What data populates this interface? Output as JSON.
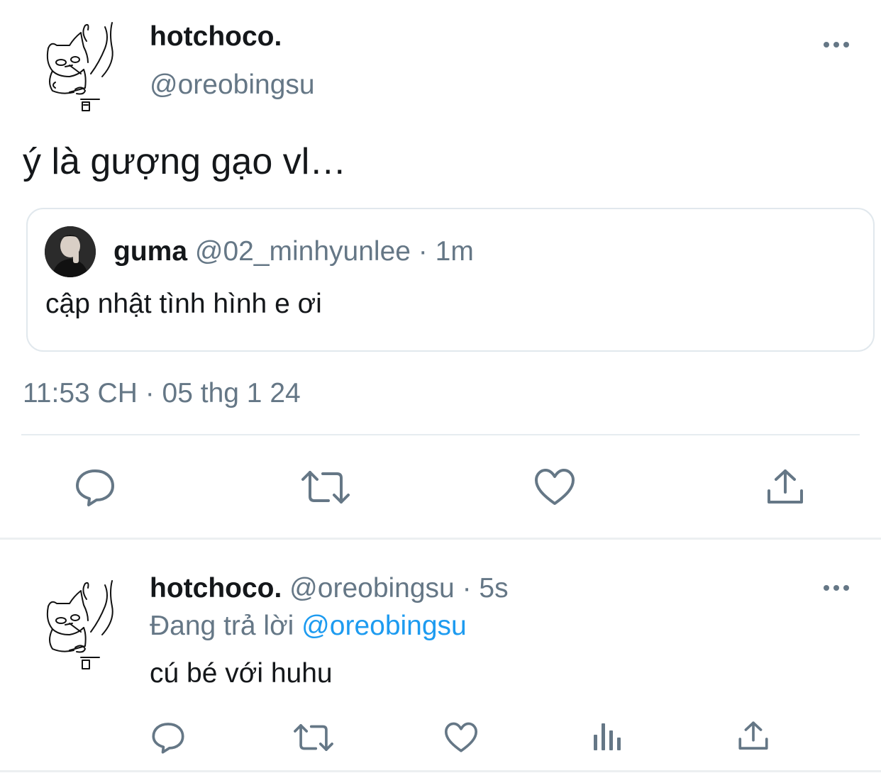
{
  "main_tweet": {
    "display_name": "hotchoco.",
    "handle": "@oreobingsu",
    "text": "ý là gượng gạo vl…",
    "timestamp": "11:53 CH · 05 thg 1 24",
    "more_icon": "more-dots-icon"
  },
  "quoted_tweet": {
    "display_name": "guma",
    "handle_time": "@02_minhyunlee · 1m",
    "text": "cập nhật tình hình e ơi"
  },
  "main_actions": [
    "reply-icon",
    "retweet-icon",
    "like-icon",
    "share-icon"
  ],
  "reply_tweet": {
    "display_name": "hotchoco.",
    "handle_time": "@oreobingsu · 5s",
    "replying_prefix": "Đang trả lời",
    "replying_to": "@oreobingsu",
    "text": "cú bé với huhu",
    "link_color": "#1d9bf0"
  },
  "reply_actions": [
    "reply-icon",
    "retweet-icon",
    "like-icon",
    "analytics-icon",
    "share-icon"
  ]
}
